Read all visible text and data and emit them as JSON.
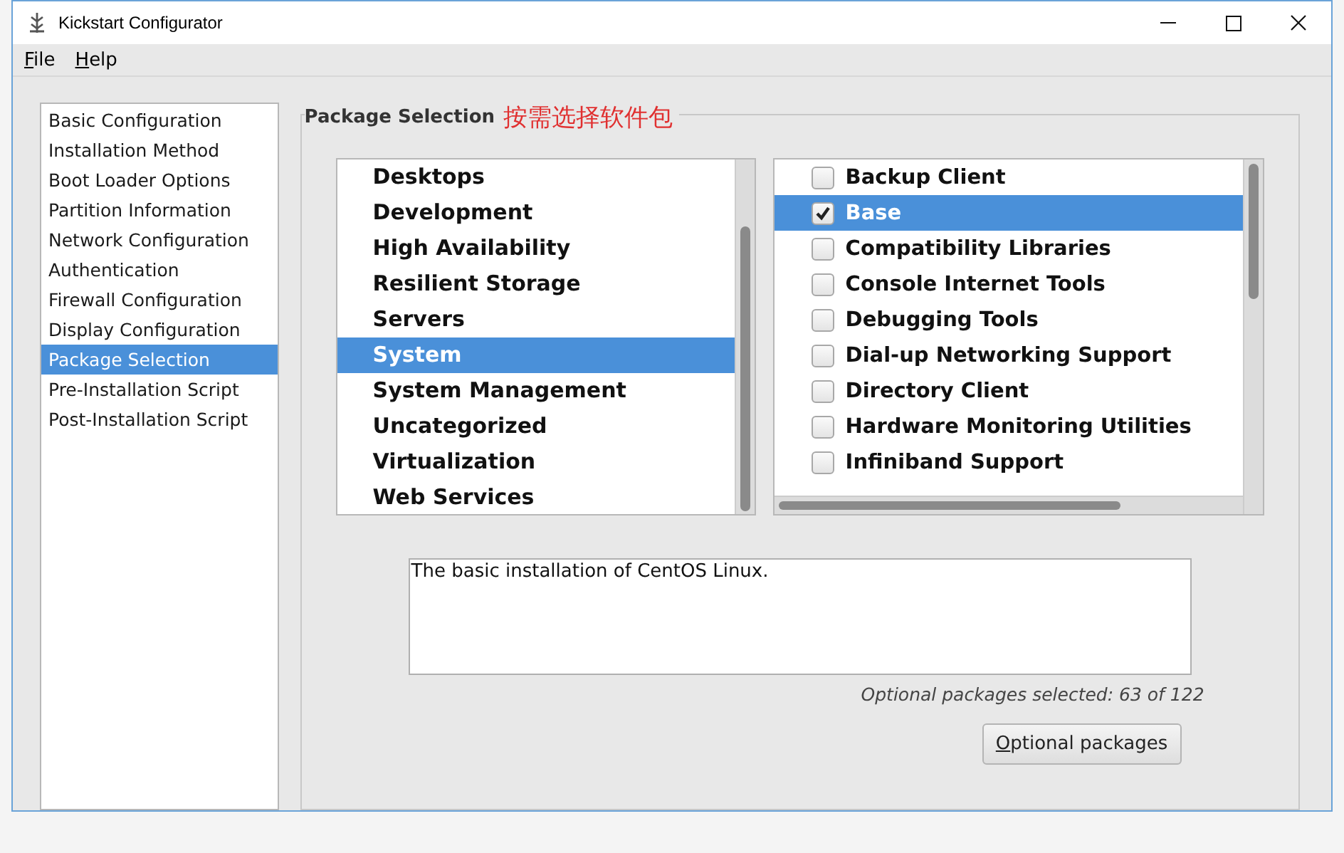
{
  "window": {
    "title": "Kickstart Configurator"
  },
  "menu": [
    {
      "label": "File"
    },
    {
      "label": "Help"
    }
  ],
  "sidebar": {
    "items": [
      {
        "label": "Basic Configuration",
        "selected": false
      },
      {
        "label": "Installation Method",
        "selected": false
      },
      {
        "label": "Boot Loader Options",
        "selected": false
      },
      {
        "label": "Partition Information",
        "selected": false
      },
      {
        "label": "Network Configuration",
        "selected": false
      },
      {
        "label": "Authentication",
        "selected": false
      },
      {
        "label": "Firewall Configuration",
        "selected": false
      },
      {
        "label": "Display Configuration",
        "selected": false
      },
      {
        "label": "Package Selection",
        "selected": true
      },
      {
        "label": "Pre-Installation Script",
        "selected": false
      },
      {
        "label": "Post-Installation Script",
        "selected": false
      }
    ]
  },
  "panel": {
    "title": "Package Selection",
    "annotation": "按需选择软件包"
  },
  "groups": [
    {
      "label": "Desktops",
      "selected": false
    },
    {
      "label": "Development",
      "selected": false
    },
    {
      "label": "High Availability",
      "selected": false
    },
    {
      "label": "Resilient Storage",
      "selected": false
    },
    {
      "label": "Servers",
      "selected": false
    },
    {
      "label": "System",
      "selected": true
    },
    {
      "label": "System Management",
      "selected": false
    },
    {
      "label": "Uncategorized",
      "selected": false
    },
    {
      "label": "Virtualization",
      "selected": false
    },
    {
      "label": "Web Services",
      "selected": false
    }
  ],
  "packages": [
    {
      "label": "Backup Client",
      "checked": false,
      "selected": false
    },
    {
      "label": "Base",
      "checked": true,
      "selected": true
    },
    {
      "label": "Compatibility Libraries",
      "checked": false,
      "selected": false
    },
    {
      "label": "Console Internet Tools",
      "checked": false,
      "selected": false
    },
    {
      "label": "Debugging Tools",
      "checked": false,
      "selected": false
    },
    {
      "label": "Dial-up Networking Support",
      "checked": false,
      "selected": false
    },
    {
      "label": "Directory Client",
      "checked": false,
      "selected": false
    },
    {
      "label": "Hardware Monitoring Utilities",
      "checked": false,
      "selected": false
    },
    {
      "label": "Infiniband Support",
      "checked": false,
      "selected": false
    }
  ],
  "description": "The basic installation of CentOS Linux.",
  "status": "Optional packages selected: 63 of 122",
  "button": "Optional packages"
}
